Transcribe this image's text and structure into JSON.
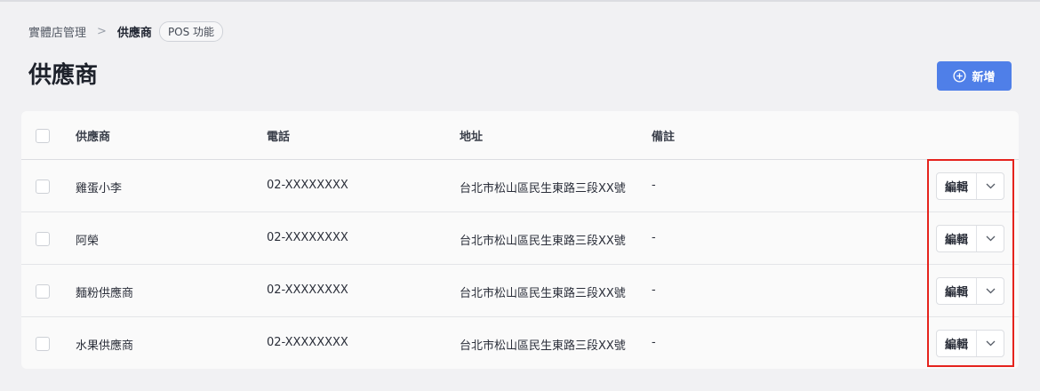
{
  "breadcrumb": {
    "parent": "實體店管理",
    "separator": ">",
    "current": "供應商",
    "tag": "POS 功能"
  },
  "page": {
    "title": "供應商",
    "add_button_label": "新增"
  },
  "table": {
    "columns": [
      "供應商",
      "電話",
      "地址",
      "備註"
    ],
    "rows": [
      {
        "name": "雞蛋小李",
        "phone": "02-XXXXXXXX",
        "address": "台北市松山區民生東路三段XX號",
        "note": "-",
        "action": "編輯"
      },
      {
        "name": "阿榮",
        "phone": "02-XXXXXXXX",
        "address": "台北市松山區民生東路三段XX號",
        "note": "-",
        "action": "編輯"
      },
      {
        "name": "麵粉供應商",
        "phone": "02-XXXXXXXX",
        "address": "台北市松山區民生東路三段XX號",
        "note": "-",
        "action": "編輯"
      },
      {
        "name": "水果供應商",
        "phone": "02-XXXXXXXX",
        "address": "台北市松山區民生東路三段XX號",
        "note": "-",
        "action": "編輯"
      }
    ]
  },
  "colors": {
    "primary": "#4f7fe8",
    "highlight_border": "#e5231d",
    "background": "#f1f1f3"
  }
}
